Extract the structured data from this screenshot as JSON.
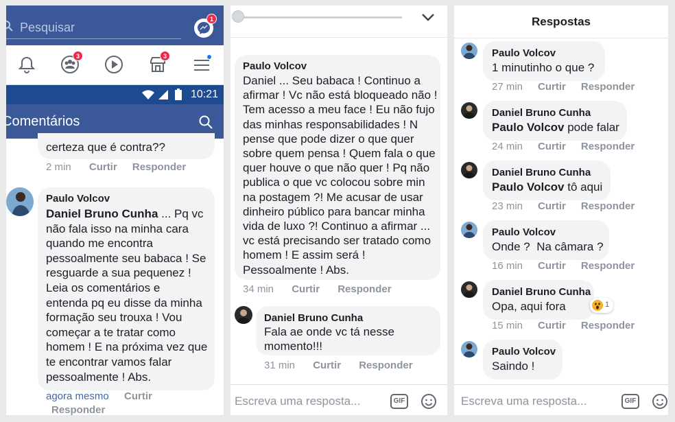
{
  "panel1": {
    "search_placeholder": "Pesquisar",
    "messenger_badge": "1",
    "friends_badge": "3",
    "marketplace_badge": "3",
    "status_time": "10:21",
    "comments_title": "Comentários",
    "prev_comment_tail": "certeza que é contra??",
    "prev_meta": {
      "time": "2 min",
      "like": "Curtir",
      "reply": "Responder"
    },
    "comment": {
      "author": "Paulo Volcov",
      "mention": "Daniel Bruno Cunha",
      "first_line_rest": " ... Pq vc",
      "lines": [
        "não fala isso na minha cara",
        "quando me encontra",
        "pessoalmente seu babaca ! Se",
        "resguarde a sua pequenez !",
        "Leia os comentários e",
        "entenda pq eu disse da minha",
        "formação seu trouxa ! Vou",
        "começar a te tratar como",
        "homem ! E na próxima vez que",
        "te encontrar vamos falar",
        "pessoalmente ! Abs."
      ],
      "time": "agora mesmo",
      "like": "Curtir",
      "reply": "Responder"
    }
  },
  "panel2": {
    "comment": {
      "author": "Paulo Volcov",
      "lines": [
        "Daniel ... Seu babaca ! Continuo a",
        "afirmar ! Vc não está bloqueado não !",
        "Tem acesso a meu face ! Eu não fujo",
        "das minhas responsabilidades ! N",
        "pense que pode dizer o que quer",
        "sobre quem pensa ! Quem fala o que",
        "quer houve o que não quer ! Pq não",
        "publica o que vc colocou sobre min",
        "na postagem ?! Me acusar de usar",
        "dinheiro público para bancar minha",
        "vida de luxo ?! Continuo a afirmar ...",
        "vc está precisando ser tratado como",
        "homem ! E assim será !",
        "Pessoalmente ! Abs."
      ],
      "time": "34 min",
      "like": "Curtir",
      "reply": "Responder"
    },
    "reply": {
      "author": "Daniel Bruno Cunha",
      "lines": [
        "Fala ae onde vc tá nesse",
        "momento!!!"
      ],
      "time": "31 min",
      "like": "Curtir",
      "reply": "Responder"
    },
    "reply_placeholder": "Escreva uma resposta...",
    "gif_label": "GIF"
  },
  "panel3": {
    "title": "Respostas",
    "replies": [
      {
        "author": "Paulo Volcov",
        "mention": "",
        "text": "1 minutinho o que ?",
        "time": "27 min",
        "like": "Curtir",
        "reply": "Responder"
      },
      {
        "author": "Daniel Bruno Cunha",
        "mention": "Paulo Volcov",
        "text": " pode falar",
        "time": "24 min",
        "like": "Curtir",
        "reply": "Responder"
      },
      {
        "author": "Daniel Bruno Cunha",
        "mention": "Paulo Volcov",
        "text": " tô aqui",
        "time": "23 min",
        "like": "Curtir",
        "reply": "Responder"
      },
      {
        "author": "Paulo Volcov",
        "mention": "",
        "text": "Onde ?  Na câmara ?",
        "time": "16 min",
        "like": "Curtir",
        "reply": "Responder"
      },
      {
        "author": "Daniel Bruno Cunha",
        "mention": "",
        "text": "Opa, aqui fora",
        "time": "15 min",
        "like": "Curtir",
        "reply": "Responder",
        "reaction_count": "1"
      },
      {
        "author": "Paulo Volcov",
        "mention": "",
        "text": "Saindo !",
        "time": "",
        "like": "",
        "reply": ""
      }
    ],
    "reply_placeholder": "Escreva uma resposta...",
    "gif_label": "GIF"
  }
}
